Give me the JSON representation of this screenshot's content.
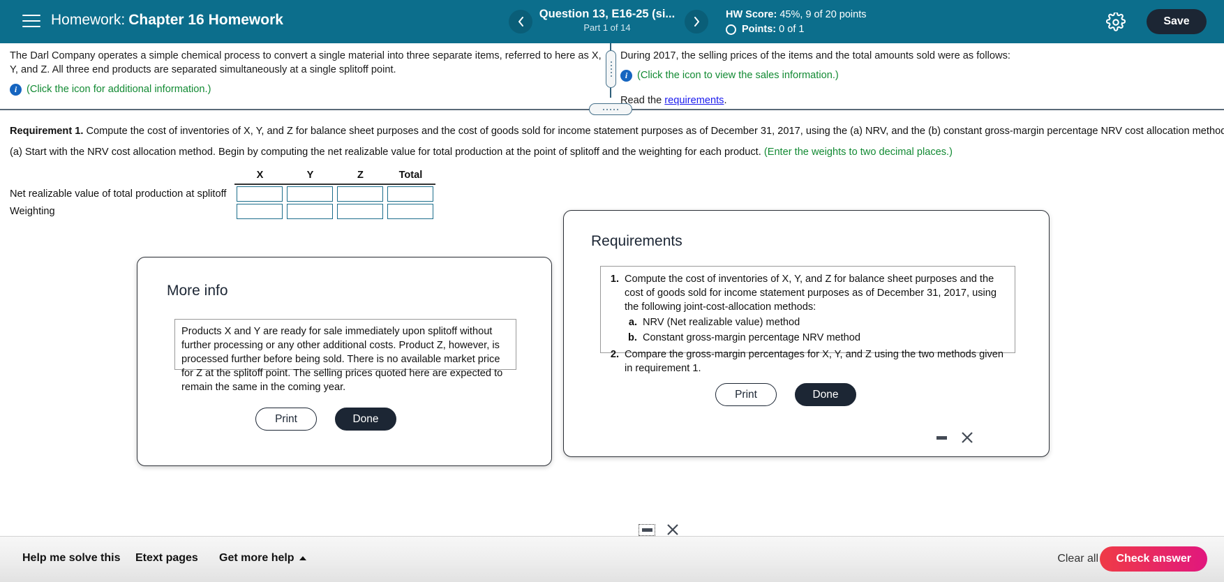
{
  "header": {
    "menu_icon": "hamburger-icon",
    "homework_label": "Homework:",
    "homework_name": "Chapter 16 Homework",
    "prev_icon": "chevron-left-icon",
    "next_icon": "chevron-right-icon",
    "question_title": "Question 13, E16-25 (si...",
    "question_part": "Part 1 of 14",
    "hw_score_label": "HW Score:",
    "hw_score_value": "45%, 9 of 20 points",
    "points_label": "Points:",
    "points_value": "0 of 1",
    "settings_icon": "gear-icon",
    "save_label": "Save",
    "bg_color": "#0c6e8c",
    "save_bg_color": "#1c2634"
  },
  "problem": {
    "left_text": "The Darl Company operates a simple chemical process to convert a single material into three separate items, referred to here as X, Y, and Z. All three end products are separated simultaneously at a single splitoff point.",
    "left_info_link": "(Click the icon for additional information.)",
    "right_text": "During 2017, the selling prices of the items and the total amounts sold were as follows:",
    "right_info_link": "(Click the icon to view the sales information.)",
    "read_prefix": "Read the ",
    "read_link": "requirements",
    "read_suffix": ".",
    "info_icon": "info-circle-icon",
    "link_color": "#128a33"
  },
  "work": {
    "requirement_label": "Requirement 1.",
    "requirement_text": " Compute the cost of inventories of X, Y, and Z for balance sheet purposes and the cost of goods sold for income statement purposes as of December 31, 2017, using the (a) NRV, and the (b) constant gross-margin percentage NRV cost allocation methods.",
    "sub_text": "(a) Start with the NRV cost allocation method. Begin by computing the net realizable value for total production at the point of splitoff and the weighting for each product. ",
    "sub_hint": "(Enter the weights to two decimal places.)",
    "table": {
      "columns": [
        "X",
        "Y",
        "Z",
        "Total"
      ],
      "rows": [
        {
          "label": "Net realizable value of total production at splitoff",
          "values": [
            "",
            "",
            "",
            ""
          ]
        },
        {
          "label": "Weighting",
          "values": [
            "",
            "",
            "",
            ""
          ]
        }
      ]
    }
  },
  "more_info_dialog": {
    "title": "More info",
    "minimize_icon": "minimize-icon",
    "close_icon": "close-icon",
    "body": "Products X and Y are ready for sale immediately upon splitoff without further processing or any other additional costs. Product Z, however, is processed further before being sold. There is no available market price for Z at the splitoff point. The selling prices quoted here are expected to remain the same in the coming year.",
    "print_label": "Print",
    "done_label": "Done"
  },
  "requirements_dialog": {
    "title": "Requirements",
    "minimize_icon": "minimize-icon",
    "close_icon": "close-icon",
    "items": [
      {
        "num": "1.",
        "text": "Compute the cost of inventories of X, Y, and Z for balance sheet purposes and the cost of goods sold for income statement purposes as of December 31, 2017, using the following joint-cost-allocation methods:",
        "subitems": [
          {
            "num": "a.",
            "text": "NRV (Net realizable value) method"
          },
          {
            "num": "b.",
            "text": "Constant gross-margin percentage NRV method"
          }
        ]
      },
      {
        "num": "2.",
        "text": "Compare the gross-margin percentages for X, Y, and Z using the two methods given in requirement 1.",
        "subitems": []
      }
    ],
    "print_label": "Print",
    "done_label": "Done"
  },
  "footer": {
    "help_label": "Help me solve this",
    "etext_label": "Etext pages",
    "more_help_label": "Get more help",
    "more_help_icon": "caret-up-icon",
    "clear_label": "Clear all",
    "check_label": "Check answer",
    "check_color_start": "#ef3b46",
    "check_color_end": "#e1177e"
  }
}
